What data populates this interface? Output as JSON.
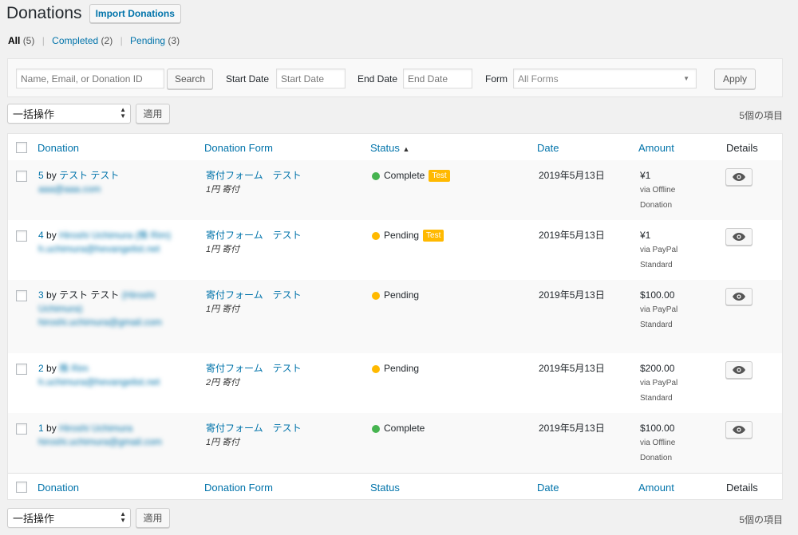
{
  "header": {
    "title": "Donations",
    "import_button": "Import Donations"
  },
  "views": {
    "all": {
      "label": "All",
      "count": "(5)"
    },
    "completed": {
      "label": "Completed",
      "count": "(2)"
    },
    "pending": {
      "label": "Pending",
      "count": "(3)"
    },
    "separator": "|"
  },
  "filters": {
    "search_placeholder": "Name, Email, or Donation ID",
    "search_button": "Search",
    "start_date_label": "Start Date",
    "start_date_placeholder": "Start Date",
    "end_date_label": "End Date",
    "end_date_placeholder": "End Date",
    "form_label": "Form",
    "form_selected": "All Forms",
    "apply_button": "Apply"
  },
  "bulk": {
    "action_selected": "一括操作",
    "apply_button": "適用",
    "items_count": "5個の項目"
  },
  "columns": {
    "donation": "Donation",
    "donation_form": "Donation Form",
    "status": "Status",
    "date": "Date",
    "amount": "Amount",
    "details": "Details",
    "sort_indicator": "▲"
  },
  "rows": [
    {
      "id": "5",
      "by": "by",
      "donor": "テスト テスト",
      "donor_extra": "",
      "email": "aaa@aaa.com",
      "form": "寄付フォーム　テスト",
      "level": "1円 寄付",
      "status": "Complete",
      "status_color": "#46b450",
      "test": "Test",
      "date": "2019年5月13日",
      "amount": "¥1",
      "gateway": "via Offline Donation"
    },
    {
      "id": "4",
      "by": "by",
      "donor": "",
      "donor_extra": "Hiroshi Uchimura (株 Rim)",
      "email": "h.uchimura@hevangelist.net",
      "form": "寄付フォーム　テスト",
      "level": "1円 寄付",
      "status": "Pending",
      "status_color": "#ffb900",
      "test": "Test",
      "date": "2019年5月13日",
      "amount": "¥1",
      "gateway": "via PayPal Standard"
    },
    {
      "id": "3",
      "by": "by",
      "donor": "テスト テスト",
      "donor_extra": "(Hiroshi Uchimura)",
      "email": "hiroshi.uchimura@gmail.com",
      "form": "寄付フォーム　テスト",
      "level": "1円 寄付",
      "status": "Pending",
      "status_color": "#ffb900",
      "test": "",
      "date": "2019年5月13日",
      "amount": "$100.00",
      "gateway": "via PayPal Standard"
    },
    {
      "id": "2",
      "by": "by",
      "donor": "",
      "donor_extra": "株 Rim",
      "email": "h.uchimura@hevangelist.net",
      "form": "寄付フォーム　テスト",
      "level": "2円 寄付",
      "status": "Pending",
      "status_color": "#ffb900",
      "test": "",
      "date": "2019年5月13日",
      "amount": "$200.00",
      "gateway": "via PayPal Standard"
    },
    {
      "id": "1",
      "by": "by",
      "donor": "",
      "donor_extra": "Hiroshi Uchimura",
      "email": "hiroshi.uchimura@gmail.com",
      "form": "寄付フォーム　テスト",
      "level": "1円 寄付",
      "status": "Complete",
      "status_color": "#46b450",
      "test": "",
      "date": "2019年5月13日",
      "amount": "$100.00",
      "gateway": "via Offline Donation"
    }
  ],
  "icons": {
    "view": "eye-icon",
    "sort": "sort-asc-icon",
    "dropdown": "chevron-down-icon"
  }
}
